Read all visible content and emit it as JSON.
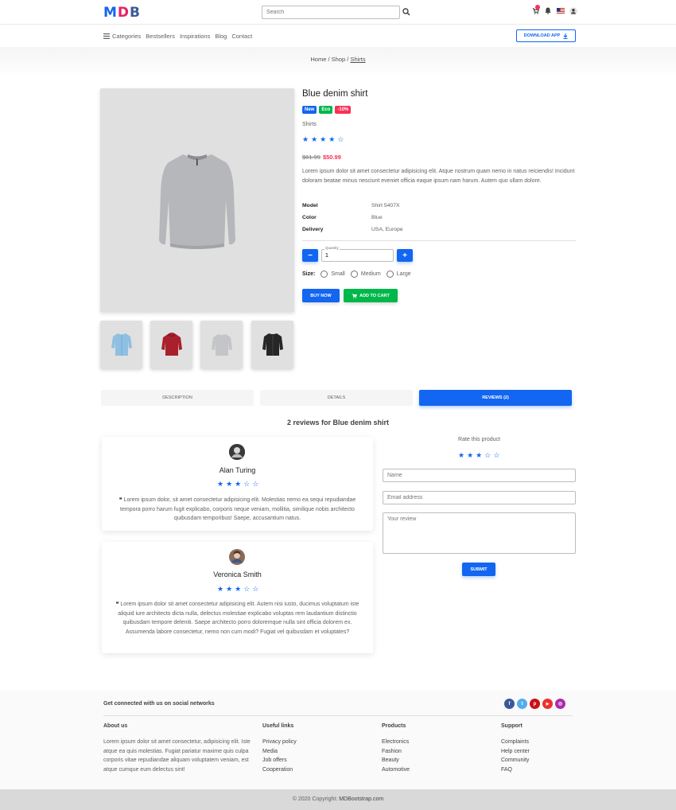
{
  "header": {
    "logo": {
      "m": "M",
      "d": "D",
      "b": "B"
    },
    "search_placeholder": "Search",
    "icons": [
      "search-icon",
      "cart-icon",
      "bell-icon",
      "flag-icon",
      "user-icon"
    ]
  },
  "nav": {
    "categories": "Categories",
    "links": [
      "Bestsellers",
      "Inspirations",
      "Blog",
      "Contact"
    ],
    "download": "Download app"
  },
  "breadcrumb": {
    "home": "Home",
    "shop": "Shop",
    "current": "Shirts"
  },
  "product": {
    "title": "Blue denim shirt",
    "badges": [
      {
        "label": "New",
        "color": "#1266f1"
      },
      {
        "label": "Eco",
        "color": "#00b74a"
      },
      {
        "label": "-10%",
        "color": "#f93154"
      }
    ],
    "category": "Shirts",
    "rating": 4,
    "price_old": "$61.99",
    "price_new": "$50.99",
    "description": "Lorem ipsum dolor sit amet consectetur adipisicing elit. Atque nostrum quam nemo in natus reiciendis! Incidunt doloram beatae minus nesciunt eveniet officia eaque ipsum nam harum. Autem quo ullam dolore.",
    "specs": [
      {
        "label": "Model",
        "value": "Shirt 5407X"
      },
      {
        "label": "Color",
        "value": "Blue"
      },
      {
        "label": "Delivery",
        "value": "USA, Europe"
      }
    ],
    "quantity_label": "Quantity",
    "quantity": "1",
    "minus": "−",
    "plus": "+",
    "size_label": "Size:",
    "sizes": [
      "Small",
      "Medium",
      "Large"
    ],
    "buy_now": "Buy now",
    "add_to_cart": "Add to cart"
  },
  "tabs": [
    "Description",
    "Details",
    "Reviews (2)"
  ],
  "reviews": {
    "title": "2 reviews for Blue denim shirt",
    "items": [
      {
        "name": "Alan Turing",
        "rating": 3,
        "text": "Lorem ipsum dolor, sit amet consectetur adipisicing elit. Molestias nemo ea sequi repudiandae tempora porro harum fugit explicabo, corporis neque veniam, mollitia, similique nobis architecto quibusdam temporibus! Saepe, accusantium natus."
      },
      {
        "name": "Veronica Smith",
        "rating": 3,
        "text": "Lorem ipsum dolor sit amet consectetur adipisicing elit. Autem nisi iusto, ducimus voluptatum iste aliquid iure architecto dicta nulla, delectus molestiae explicabo voluptas rem laudantium distinctio quibusdam tempore deleniti. Saepe architecto porro doloremque nulla sint officia dolorem ex. Assumenda labore consectetur, nemo non cum modi? Fugiat vel quibusdam et voluptates?"
      }
    ]
  },
  "review_form": {
    "rate_label": "Rate this product",
    "rating": 3,
    "name_placeholder": "Name",
    "email_placeholder": "Email address",
    "review_placeholder": "Your review",
    "submit": "Submit"
  },
  "footer": {
    "social_title": "Get connected with us on social networks",
    "socials": [
      {
        "icon": "facebook-icon",
        "glyph": "f",
        "color": "#3b5998"
      },
      {
        "icon": "twitter-icon",
        "glyph": "t",
        "color": "#55acee"
      },
      {
        "icon": "pinterest-icon",
        "glyph": "p",
        "color": "#c61118"
      },
      {
        "icon": "youtube-icon",
        "glyph": "▶",
        "color": "#ed302f"
      },
      {
        "icon": "instagram-icon",
        "glyph": "◎",
        "color": "#ac2bac"
      }
    ],
    "about_title": "About us",
    "about_text": "Lorem ipsum dolor sit amet consectetur, adipisicing elit. Iste atque ea quis molestias. Fugiat pariatur maxime quis culpa corporis vitae repudiandae aliquam voluptatem veniam, est atque cumque eum delectus sint!",
    "columns": [
      {
        "title": "Useful links",
        "links": [
          "Privacy policy",
          "Media",
          "Job offers",
          "Cooperation"
        ]
      },
      {
        "title": "Products",
        "links": [
          "Electronics",
          "Fashion",
          "Beauty",
          "Automotive"
        ]
      },
      {
        "title": "Support",
        "links": [
          "Complaints",
          "Help center",
          "Community",
          "FAQ"
        ]
      }
    ],
    "copyright_prefix": "© 2020 Copyright:",
    "copyright_site": "MDBootstrap.com"
  }
}
